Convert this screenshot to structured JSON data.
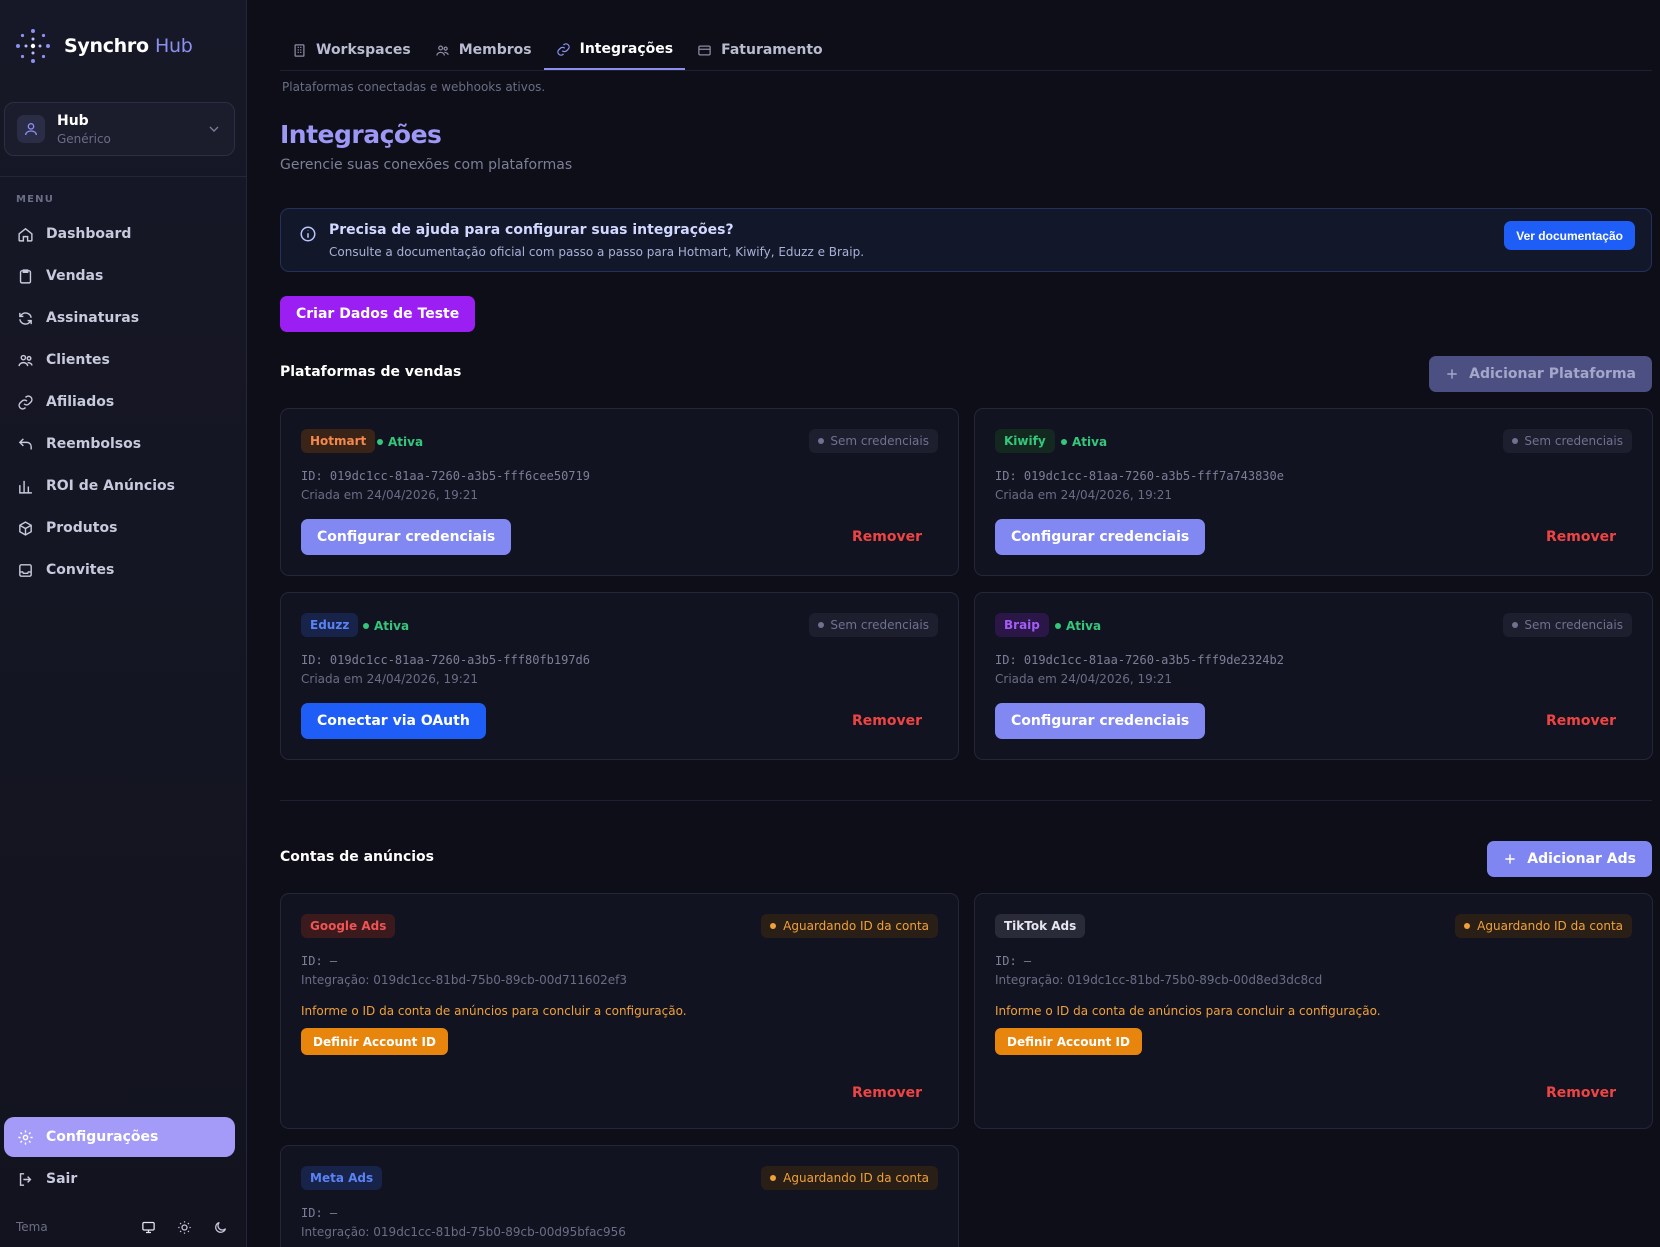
{
  "brand": {
    "name": "Synchro",
    "suffix": "Hub"
  },
  "workspace": {
    "name": "Hub",
    "type": "Genérico"
  },
  "sidebar": {
    "menu_label": "MENU",
    "items": [
      {
        "label": "Dashboard",
        "icon": "home-icon"
      },
      {
        "label": "Vendas",
        "icon": "clipboard-icon"
      },
      {
        "label": "Assinaturas",
        "icon": "refresh-icon"
      },
      {
        "label": "Clientes",
        "icon": "users-icon"
      },
      {
        "label": "Afiliados",
        "icon": "link-icon"
      },
      {
        "label": "Reembolsos",
        "icon": "undo-icon"
      },
      {
        "label": "ROI de Anúncios",
        "icon": "bar-chart-icon"
      },
      {
        "label": "Produtos",
        "icon": "box-icon"
      },
      {
        "label": "Convites",
        "icon": "inbox-icon"
      }
    ],
    "settings_label": "Configurações",
    "logout_label": "Sair",
    "theme_label": "Tema"
  },
  "tabs": [
    {
      "label": "Workspaces",
      "icon": "building-icon"
    },
    {
      "label": "Membros",
      "icon": "users-icon"
    },
    {
      "label": "Integrações",
      "icon": "link-icon",
      "active": true
    },
    {
      "label": "Faturamento",
      "icon": "credit-card-icon"
    }
  ],
  "tab_subtitle": "Plataformas conectadas e webhooks ativos.",
  "page": {
    "title": "Integrações",
    "subtitle": "Gerencie suas conexões com plataformas"
  },
  "help": {
    "title": "Precisa de ajuda para configurar suas integrações?",
    "description": "Consulte a documentação oficial com passo a passo para Hotmart, Kiwify, Eduzz e Braip.",
    "button": "Ver documentação"
  },
  "test_button": "Criar Dados de Teste",
  "platforms": {
    "title": "Plataformas de vendas",
    "add_button": "Adicionar Plataforma",
    "cards": [
      {
        "name": "Hotmart",
        "status": "Ativa",
        "cred": "Sem credenciais",
        "id": "ID: 019dc1cc-81aa-7260-a3b5-fff6cee50719",
        "created": "Criada em 24/04/2026, 19:21",
        "action": "Configurar credenciais",
        "remove": "Remover"
      },
      {
        "name": "Kiwify",
        "status": "Ativa",
        "cred": "Sem credenciais",
        "id": "ID: 019dc1cc-81aa-7260-a3b5-fff7a743830e",
        "created": "Criada em 24/04/2026, 19:21",
        "action": "Configurar credenciais",
        "remove": "Remover"
      },
      {
        "name": "Eduzz",
        "status": "Ativa",
        "cred": "Sem credenciais",
        "id": "ID: 019dc1cc-81aa-7260-a3b5-fff80fb197d6",
        "created": "Criada em 24/04/2026, 19:21",
        "action": "Conectar via OAuth",
        "remove": "Remover"
      },
      {
        "name": "Braip",
        "status": "Ativa",
        "cred": "Sem credenciais",
        "id": "ID: 019dc1cc-81aa-7260-a3b5-fff9de2324b2",
        "created": "Criada em 24/04/2026, 19:21",
        "action": "Configurar credenciais",
        "remove": "Remover"
      }
    ]
  },
  "ads": {
    "title": "Contas de anúncios",
    "add_button": "Adicionar Ads",
    "cards": [
      {
        "name": "Google Ads",
        "status": "Aguardando ID da conta",
        "id": "ID: —",
        "integration": "Integração: 019dc1cc-81bd-75b0-89cb-00d711602ef3",
        "warning": "Informe o ID da conta de anúncios para concluir a configuração.",
        "action": "Definir Account ID",
        "remove": "Remover"
      },
      {
        "name": "TikTok Ads",
        "status": "Aguardando ID da conta",
        "id": "ID: —",
        "integration": "Integração: 019dc1cc-81bd-75b0-89cb-00d8ed3dc8cd",
        "warning": "Informe o ID da conta de anúncios para concluir a configuração.",
        "action": "Definir Account ID",
        "remove": "Remover"
      },
      {
        "name": "Meta Ads",
        "status": "Aguardando ID da conta",
        "id": "ID: —",
        "integration": "Integração: 019dc1cc-81bd-75b0-89cb-00d95bfac956"
      }
    ]
  },
  "colors": {
    "accent": "#8b8ff0",
    "success": "#34c77b",
    "danger": "#ef4444",
    "warning": "#f0a13a",
    "primary_blue": "#1f5ef6",
    "purple": "#9b1ff2"
  }
}
